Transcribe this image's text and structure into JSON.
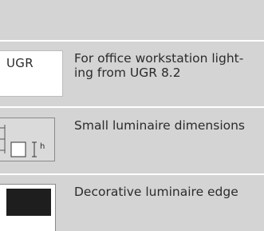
{
  "rows": [
    {
      "icon_label": "UGR",
      "text": "For office workstation light-\ning from UGR 8.2"
    },
    {
      "icon_label": "h",
      "text": "Small luminaire dimensions"
    },
    {
      "icon_label": "",
      "text": "Decorative luminaire edge"
    }
  ],
  "colors": {
    "background": "#d4d4d4",
    "divider": "#ffffff",
    "icon_dark": "#1e1e1e"
  },
  "icons": [
    "ugr-icon",
    "dimensions-icon",
    "edge-icon"
  ]
}
